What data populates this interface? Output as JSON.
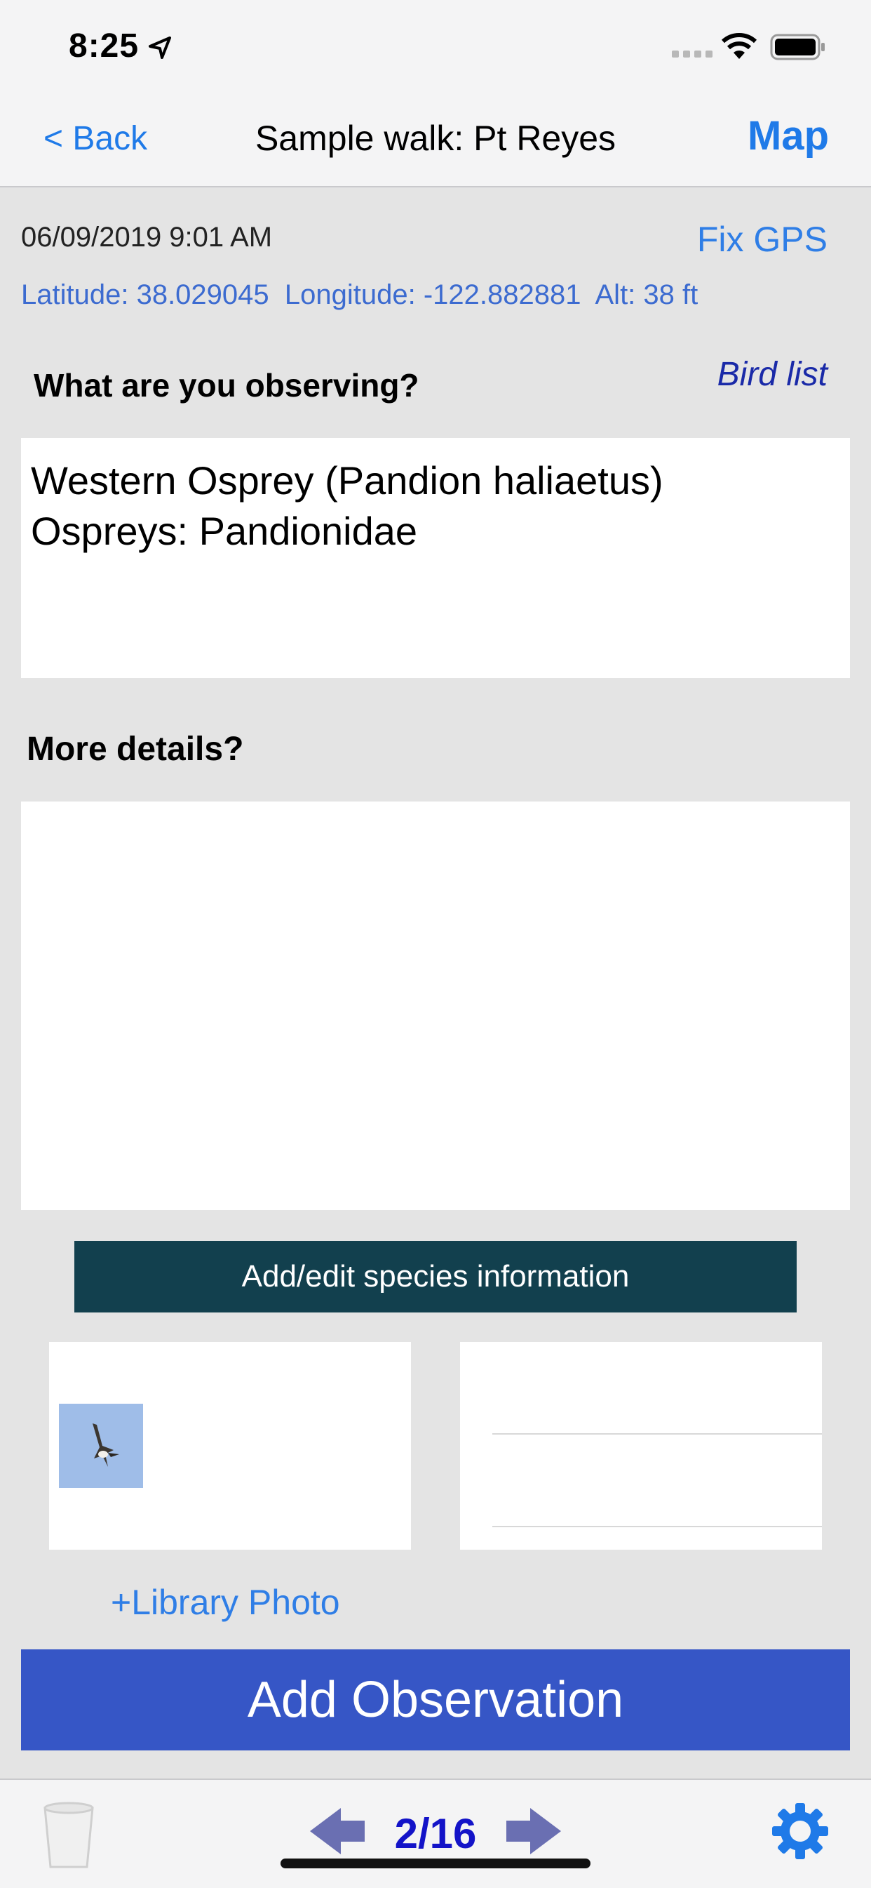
{
  "status": {
    "time": "8:25"
  },
  "nav": {
    "back": "< Back",
    "title": "Sample walk: Pt Reyes",
    "map": "Map"
  },
  "record": {
    "datetime": "06/09/2019 9:01 AM",
    "fix_gps": "Fix GPS",
    "coords": "Latitude: 38.029045  Longitude: -122.882881  Alt: 38 ft"
  },
  "observe": {
    "question": "What are you observing?",
    "bird_list": "Bird list",
    "line1": "Western Osprey (Pandion haliaetus)",
    "line2": "Ospreys: Pandionidae"
  },
  "details": {
    "question": "More details?",
    "value": ""
  },
  "buttons": {
    "species_info": "Add/edit species information",
    "library_photo": "+Library Photo",
    "add_observation": "Add Observation"
  },
  "pager": {
    "label": "2/16"
  },
  "colors": {
    "accent": "#1f7ae8",
    "add_button": "#3656c6",
    "species_button": "#12404e",
    "pager": "#1313c8"
  },
  "icons": [
    "location-arrow-icon",
    "signal-icon",
    "wifi-icon",
    "battery-icon",
    "trash-icon",
    "prev-arrow-icon",
    "next-arrow-icon",
    "gear-icon"
  ]
}
